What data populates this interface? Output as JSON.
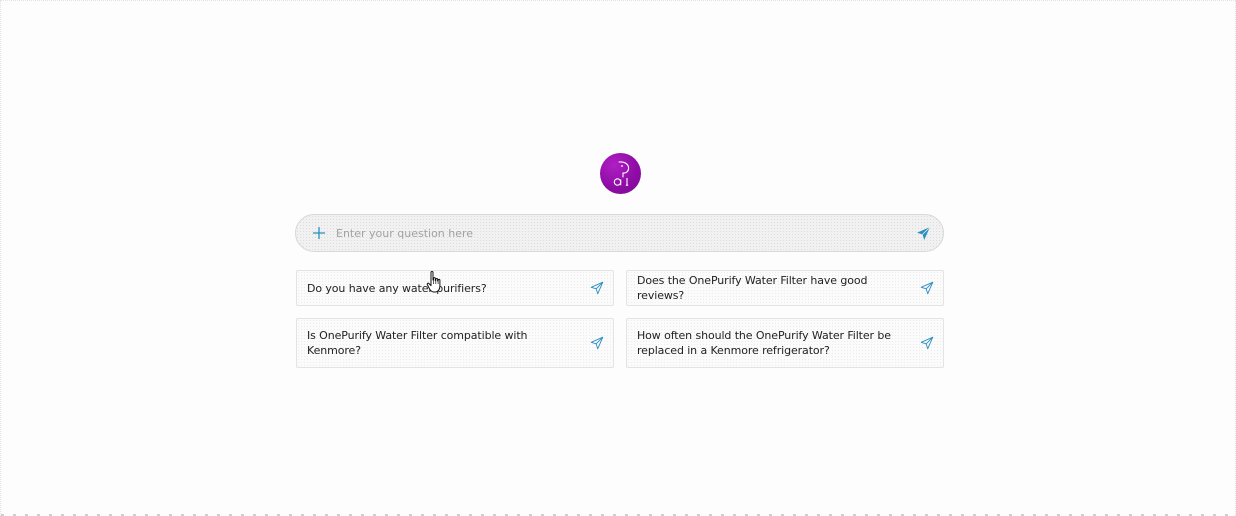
{
  "brand": {
    "logo_icon": "elephant-ai-logo",
    "logo_letters": "a I",
    "accent_color": "#8f0da6"
  },
  "search": {
    "placeholder": "Enter your question here",
    "value": "",
    "add_icon": "plus-icon",
    "send_icon": "send-icon",
    "icon_color": "#2b8fc0"
  },
  "suggestions": [
    {
      "text": "Do you have any water purifiers?",
      "icon": "send-outline-icon"
    },
    {
      "text": "Does the OnePurify Water Filter have good reviews?",
      "icon": "send-outline-icon"
    },
    {
      "text": "Is OnePurify Water Filter compatible with Kenmore?",
      "icon": "send-outline-icon"
    },
    {
      "text": "How often should the OnePurify Water Filter be replaced in a Kenmore refrigerator?",
      "icon": "send-outline-icon"
    }
  ],
  "cursor": {
    "icon": "hand-pointer-icon"
  }
}
